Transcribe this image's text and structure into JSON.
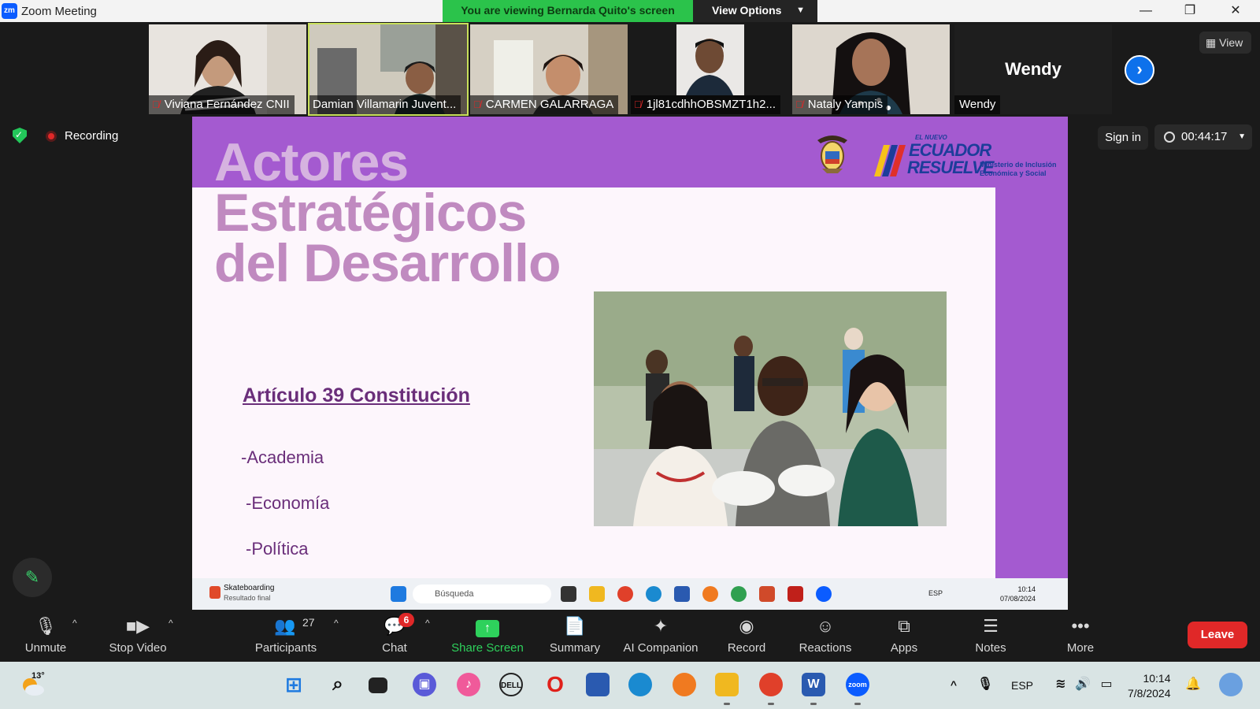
{
  "window": {
    "title": "Zoom Meeting",
    "app_logo_text": "zm",
    "viewing_banner": "You are viewing Bernarda Quito's screen",
    "view_options_label": "View Options",
    "minimize_glyph": "—",
    "restore_glyph": "❐",
    "close_glyph": "✕"
  },
  "gallery": {
    "participants": [
      {
        "name": "Viviana Fernández CNII",
        "muted": true
      },
      {
        "name": "Damian Villamarin Juvent...",
        "muted": false,
        "active": true
      },
      {
        "name": "CARMEN GALARRAGA",
        "muted": true
      },
      {
        "name": "1jl81cdhhOBSMZT1h2...",
        "muted": true
      },
      {
        "name": "Nataly Yampis",
        "muted": true
      }
    ],
    "no_video_participant": {
      "display_name": "Wendy",
      "label": "Wendy"
    },
    "next_page_glyph": "›",
    "view_label": "View"
  },
  "status": {
    "recording_label": "Recording",
    "sign_in_label": "Sign in",
    "timer": "00:44:17"
  },
  "slide": {
    "title_lines": [
      "Actores",
      "Estratégicos",
      "del Desarrollo"
    ],
    "logo": {
      "el_nuevo": "EL NUEVO",
      "ecuador": "ECUADOR",
      "resuelve": "RESUELVE",
      "ministry_1": "Ministerio de Inclusión",
      "ministry_2": "Económica y Social"
    },
    "heading": "Artículo 39 Constitución",
    "bullets": [
      "-Academia",
      "-Economía",
      "-Política"
    ]
  },
  "remote_taskbar": {
    "news_title": "Skateboarding",
    "news_sub": "Resultado final",
    "search_placeholder": "Búsqueda",
    "lang": "ESP",
    "time": "10:14",
    "date": "07/08/2024"
  },
  "toolbar": {
    "unmute": "Unmute",
    "stop_video": "Stop Video",
    "participants": "Participants",
    "participants_count": "27",
    "chat": "Chat",
    "chat_badge": "6",
    "share_screen": "Share Screen",
    "summary": "Summary",
    "ai_companion": "AI Companion",
    "record": "Record",
    "reactions": "Reactions",
    "apps": "Apps",
    "notes": "Notes",
    "more": "More",
    "leave": "Leave"
  },
  "win_taskbar": {
    "temp": "13°",
    "lang": "ESP",
    "time": "10:14",
    "date": "7/8/2024"
  },
  "colors": {
    "zoom_blue": "#0b5cff",
    "banner_green": "#2bc34b",
    "slide_purple": "#a45ad0",
    "leave_red": "#e02828"
  }
}
